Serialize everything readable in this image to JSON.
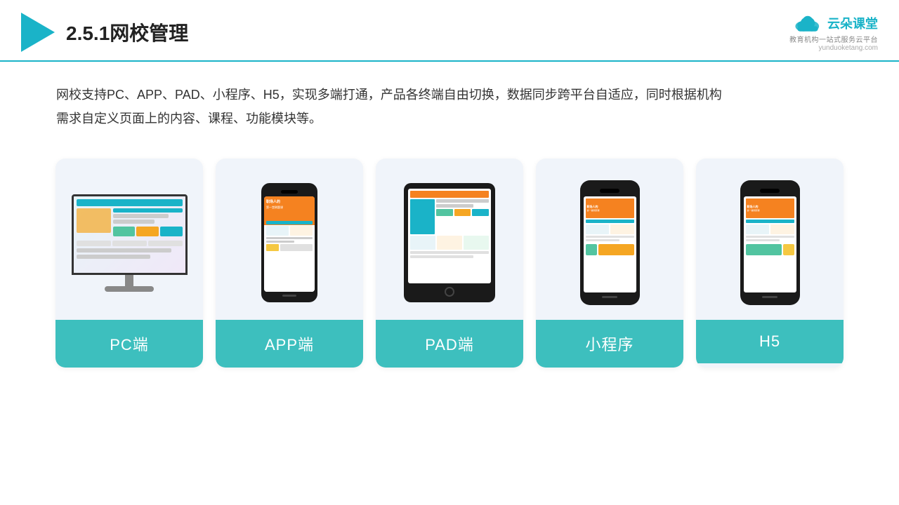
{
  "header": {
    "title": "2.5.1网校管理",
    "brand_name": "云朵课堂",
    "brand_url": "yunduoketang.com",
    "brand_tagline": "教育机构一站",
    "brand_tagline2": "式服务云平台"
  },
  "description": "网校支持PC、APP、PAD、小程序、H5，实现多端打通，产品各终端自由切换，数据同步跨平台自适应，同时根据机构",
  "description2": "需求自定义页面上的内容、课程、功能模块等。",
  "cards": [
    {
      "id": "pc",
      "label": "PC端"
    },
    {
      "id": "app",
      "label": "APP端"
    },
    {
      "id": "pad",
      "label": "PAD端"
    },
    {
      "id": "miniprogram",
      "label": "小程序"
    },
    {
      "id": "h5",
      "label": "H5"
    }
  ]
}
